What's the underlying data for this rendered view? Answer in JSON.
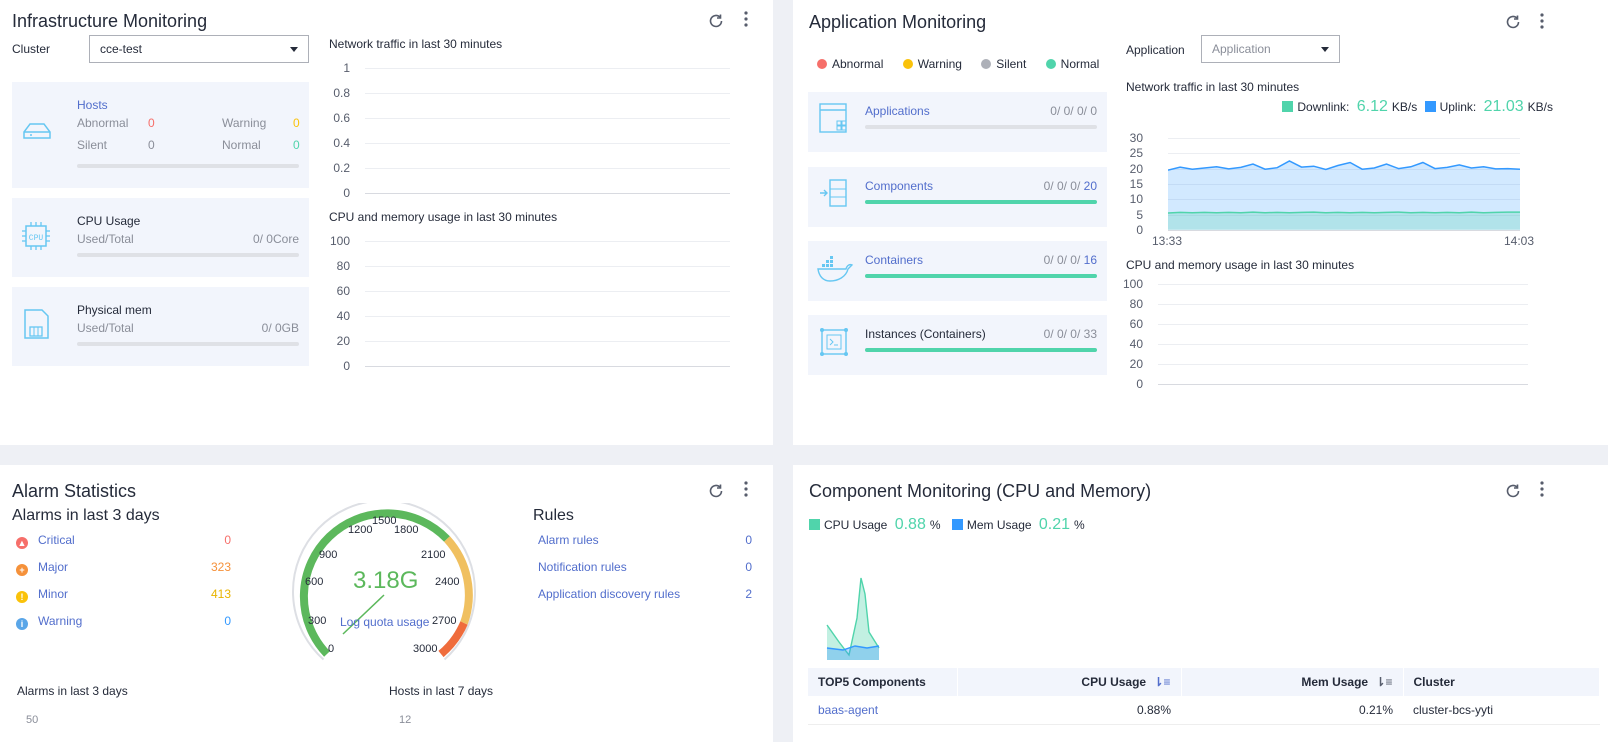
{
  "infra": {
    "title": "Infrastructure Monitoring",
    "cluster_label": "Cluster",
    "cluster_value": "cce-test",
    "network_title": "Network traffic in last 30 minutes",
    "network_ticks": [
      "1",
      "0.8",
      "0.6",
      "0.4",
      "0.2",
      "0"
    ],
    "cpu_mem_title": "CPU and memory usage in last 30 minutes",
    "cpu_mem_ticks": [
      "100",
      "80",
      "60",
      "40",
      "20",
      "0"
    ],
    "hosts": {
      "label": "Hosts",
      "abnormal_label": "Abnormal",
      "abnormal_value": "0",
      "warning_label": "Warning",
      "warning_value": "0",
      "silent_label": "Silent",
      "silent_value": "0",
      "normal_label": "Normal",
      "normal_value": "0"
    },
    "cpu": {
      "label": "CPU Usage",
      "sub": "Used/Total",
      "value": "0/ 0Core"
    },
    "mem": {
      "label": "Physical mem",
      "sub": "Used/Total",
      "value": "0/ 0GB"
    }
  },
  "app": {
    "title": "Application Monitoring",
    "legend": [
      {
        "label": "Abnormal",
        "color": "#f66f6a"
      },
      {
        "label": "Warning",
        "color": "#fac20a"
      },
      {
        "label": "Silent",
        "color": "#adb0b8"
      },
      {
        "label": "Normal",
        "color": "#50d4ab"
      }
    ],
    "app_label": "Application",
    "app_placeholder": "Application",
    "items": [
      {
        "label": "Applications",
        "prefix": "0/ 0/ 0/ ",
        "count": "0",
        "fill": 0
      },
      {
        "label": "Components",
        "prefix": "0/ 0/ 0/ ",
        "count": "20",
        "fill": 1
      },
      {
        "label": "Containers",
        "prefix": "0/ 0/ 0/ ",
        "count": "16",
        "fill": 1
      },
      {
        "label": "Instances (Containers)",
        "prefix": "0/ 0/ 0/ ",
        "count": "33",
        "fill": 1
      }
    ],
    "network_title": "Network traffic in last 30 minutes",
    "downlink_label": "Downlink:",
    "downlink_value": "6.12",
    "downlink_unit": "KB/s",
    "uplink_label": "Uplink:",
    "uplink_value": "21.03",
    "uplink_unit": "KB/s",
    "net_ticks": [
      "30",
      "25",
      "20",
      "15",
      "10",
      "5",
      "0"
    ],
    "net_x": [
      "13:33",
      "14:03"
    ],
    "cpu_mem_title": "CPU and memory usage in last 30 minutes",
    "cpu_mem_ticks": [
      "100",
      "80",
      "60",
      "40",
      "20",
      "0"
    ],
    "colors": {
      "downlink": "#50d4ab",
      "uplink": "#3399ff"
    }
  },
  "chart_data": {
    "type": "area",
    "title": "Network traffic in last 30 minutes",
    "x": [
      "13:33",
      "14:03"
    ],
    "ylim": [
      0,
      30
    ],
    "series": [
      {
        "name": "Uplink",
        "values": [
          19.5,
          20.5,
          19.8,
          20.2,
          20.6,
          19.9,
          20.4,
          21.5,
          19.8,
          20.3,
          22.5,
          20.5,
          20.8,
          19.7,
          21.0,
          22.0,
          19.8,
          20.2,
          21.5,
          20.0,
          20.6,
          22.0,
          20.0,
          20.4,
          21.2,
          20.2,
          20.6,
          19.9,
          20.0,
          19.8
        ]
      },
      {
        "name": "Downlink",
        "values": [
          5.5,
          5.7,
          5.6,
          5.7,
          5.6,
          5.7,
          5.6,
          5.8,
          5.6,
          5.7,
          5.6,
          5.7,
          5.8,
          5.6,
          5.7,
          5.6,
          5.7,
          5.6,
          5.7,
          5.8,
          5.6,
          5.7,
          5.6,
          5.7,
          5.6,
          5.8,
          5.6,
          5.7,
          5.8,
          5.8
        ]
      }
    ]
  },
  "alarm": {
    "title": "Alarm Statistics",
    "sub": "Alarms in last 3 days",
    "severities": [
      {
        "label": "Critical",
        "value": "0",
        "color": "#f66f6a",
        "vcolor": "#f66f6a"
      },
      {
        "label": "Major",
        "value": "323",
        "color": "#f5913a",
        "vcolor": "#f5913a"
      },
      {
        "label": "Minor",
        "value": "413",
        "color": "#fac20a",
        "vcolor": "#e8b400"
      },
      {
        "label": "Warning",
        "value": "0",
        "color": "#5aa6e8",
        "vcolor": "#3399ff"
      }
    ],
    "gauge_value": "3.18G",
    "gauge_label": "Log quota usage",
    "gauge_ticks": [
      "0",
      "300",
      "600",
      "900",
      "1200",
      "1500",
      "1800",
      "2100",
      "2400",
      "2700",
      "3000"
    ],
    "rules_title": "Rules",
    "rules": [
      {
        "label": "Alarm rules",
        "value": "0"
      },
      {
        "label": "Notification rules",
        "value": "0"
      },
      {
        "label": "Application discovery rules",
        "value": "2"
      }
    ],
    "bottom_left_title": "Alarms in last 3 days",
    "bottom_left_tick": "50",
    "bottom_right_title": "Hosts in last 7 days",
    "bottom_right_tick": "12"
  },
  "comp": {
    "title": "Component Monitoring (CPU and Memory)",
    "cpu_label": "CPU Usage",
    "cpu_value": "0.88",
    "cpu_unit": "%",
    "mem_label": "Mem Usage",
    "mem_value": "0.21",
    "mem_unit": "%",
    "colors": {
      "cpu": "#50d4ab",
      "mem": "#3399ff"
    },
    "table_headers": [
      "TOP5 Components",
      "CPU Usage",
      "Mem Usage",
      "Cluster"
    ],
    "rows": [
      {
        "name": "baas-agent",
        "cpu": "0.88%",
        "mem": "0.21%",
        "cluster": "cluster-bcs-yyti"
      }
    ]
  }
}
